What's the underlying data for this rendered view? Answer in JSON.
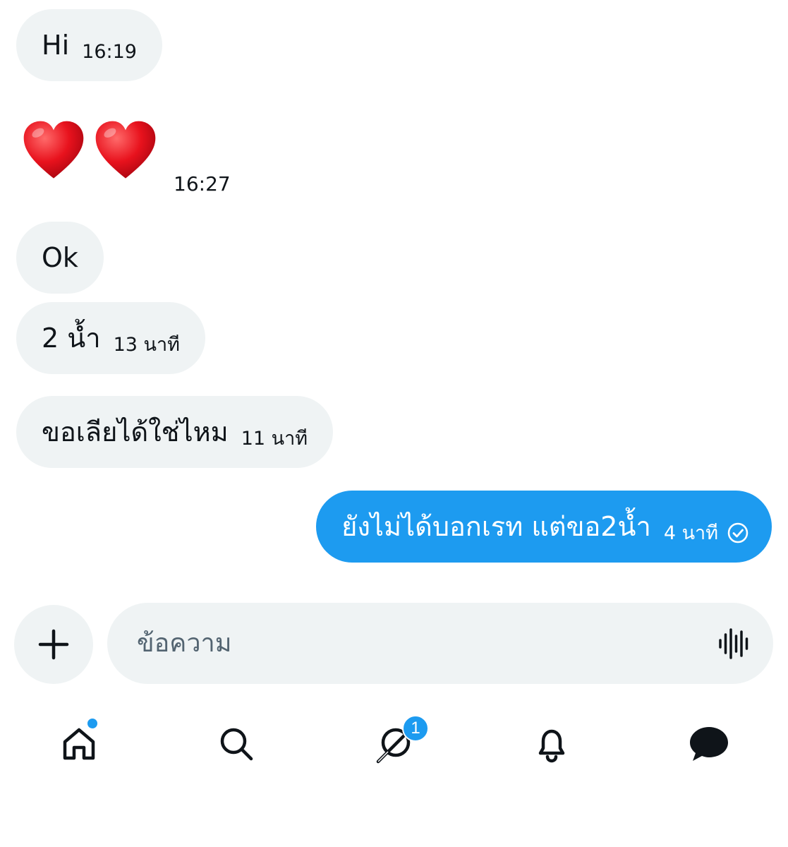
{
  "messages": [
    {
      "direction": "in",
      "text": "Hi",
      "time": "16:19"
    },
    {
      "direction": "in",
      "emoji": [
        "heart-emoji",
        "heart-emoji"
      ],
      "time": "16:27"
    },
    {
      "direction": "in",
      "text": "Ok",
      "time": ""
    },
    {
      "direction": "in",
      "text": "2 น้ำ",
      "time": "13 นาที"
    },
    {
      "direction": "in",
      "text": "ขอเลียได้ใช่ไหม",
      "time": "11 นาที"
    },
    {
      "direction": "out",
      "text": "ยังไม่ได้บอกเรท แต่ขอ2น้ำ",
      "time": "4 นาที",
      "status_icon": "sent-check-icon"
    }
  ],
  "composer": {
    "add_icon": "plus-icon",
    "placeholder": "ข้อความ",
    "voice_icon": "voice-waveform-icon"
  },
  "tabbar": {
    "tabs": [
      {
        "name": "home",
        "icon": "home-icon",
        "has_dot": true
      },
      {
        "name": "search",
        "icon": "search-icon"
      },
      {
        "name": "grok",
        "icon": "grok-icon",
        "badge": "1"
      },
      {
        "name": "notifications",
        "icon": "bell-icon"
      },
      {
        "name": "messages",
        "icon": "message-bubble-icon",
        "active": true
      }
    ]
  },
  "colors": {
    "accent": "#1d9bf0",
    "bubble_in": "#eff3f4",
    "text": "#0f1419",
    "muted": "#536471"
  }
}
